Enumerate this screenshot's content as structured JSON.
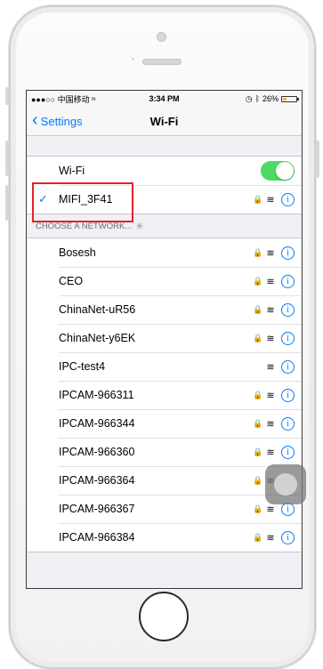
{
  "status_bar": {
    "carrier": "●●●○○ 中国移动",
    "wifi_glyph": "ᯤ",
    "time": "3:34 PM",
    "battery": "26%",
    "battery_level": 0.26
  },
  "navbar": {
    "back_label": "Settings",
    "title": "Wi-Fi"
  },
  "wifi_toggle": {
    "label": "Wi-Fi",
    "on": true
  },
  "connected_network": {
    "name": "MIFI_3F41",
    "secured": true
  },
  "section_header": "CHOOSE A NETWORK...",
  "networks": [
    {
      "name": "Bosesh",
      "secured": true
    },
    {
      "name": "CEO",
      "secured": true
    },
    {
      "name": "ChinaNet-uR56",
      "secured": true
    },
    {
      "name": "ChinaNet-y6EK",
      "secured": true
    },
    {
      "name": "IPC-test4",
      "secured": false
    },
    {
      "name": "IPCAM-966311",
      "secured": true
    },
    {
      "name": "IPCAM-966344",
      "secured": true
    },
    {
      "name": "IPCAM-966360",
      "secured": true
    },
    {
      "name": "IPCAM-966364",
      "secured": true
    },
    {
      "name": "IPCAM-966367",
      "secured": true
    },
    {
      "name": "IPCAM-966384",
      "secured": true
    }
  ],
  "colors": {
    "accent": "#007aff",
    "toggle_on": "#4cd964",
    "highlight": "#e2212b"
  }
}
